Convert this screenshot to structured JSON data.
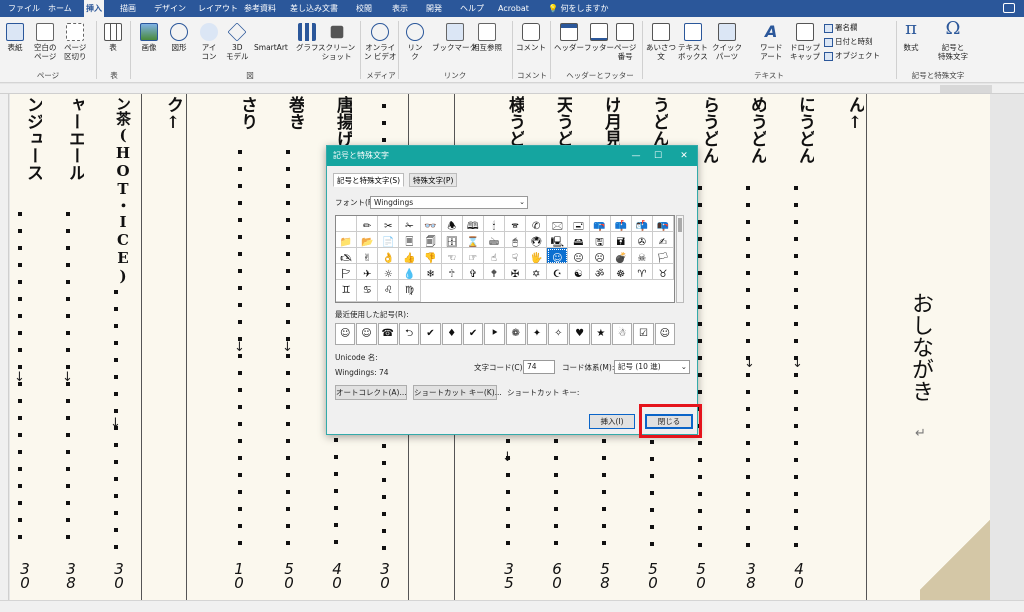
{
  "ribbon": {
    "tabs": [
      "ファイル",
      "ホーム",
      "挿入",
      "描画",
      "デザイン",
      "レイアウト",
      "参考資料",
      "差し込み文書",
      "校閲",
      "表示",
      "開発",
      "ヘルプ",
      "Acrobat"
    ],
    "active_tab": "挿入",
    "tell_me": "何をしますか",
    "buttons": {
      "cover": "表紙",
      "blank": "空白の\nページ",
      "pbreak": "ページ\n区切り",
      "table": "表",
      "picture": "画像",
      "shape": "図形",
      "icon": "アイ\nコン",
      "model3d": "3D\nモデル",
      "smartart": "SmartArt",
      "graph": "グラフ",
      "screenshot": "スクリーン\nショット",
      "online_video": "オンライ\nン ビデオ",
      "link": "リン\nク",
      "bookmark": "ブックマーク",
      "crossref": "相互参照",
      "comment": "コメント",
      "header": "ヘッダー",
      "footer": "フッター",
      "pagenum": "ページ\n番号",
      "greeting": "あいさつ\n文",
      "textbox": "テキスト\nボックス",
      "quickparts": "クイック\nパーツ",
      "wordart": "ワード\nアート",
      "dropcap": "ドロップ\nキャップ",
      "signature": "署名欄",
      "datetime": "日付と時刻",
      "object": "オブジェクト",
      "equation": "数式",
      "symbol": "記号と\n特殊文字"
    },
    "groups": [
      "ページ",
      "表",
      "図",
      "メディア",
      "リンク",
      "コメント",
      "ヘッダーとフッター",
      "テキスト",
      "記号と特殊文字"
    ]
  },
  "document": {
    "columns": [
      {
        "head": "ンジュース",
        "price": "3\n0"
      },
      {
        "head": "ャーエール",
        "price": "3\n8"
      },
      {
        "head": "ン茶(HOT・ICE)",
        "price": "3\n0"
      },
      {
        "head": "ク↑",
        "price": ""
      },
      {
        "head": "さり",
        "price": "1\n0"
      },
      {
        "head": "巻き",
        "price": "5\n0"
      },
      {
        "head": "唐揚げ",
        "price": "4\n0"
      },
      {
        "head": "",
        "price": "3\n0"
      },
      {
        "head": "様うど",
        "price": "3\n5"
      },
      {
        "head": "天うど",
        "price": "6\n0"
      },
      {
        "head": "け月見",
        "price": "5\n8"
      },
      {
        "head": "うどん",
        "price": "5\n0"
      },
      {
        "head": "らうどん",
        "price": "5\n0"
      },
      {
        "head": "めうどん",
        "price": "3\n8"
      },
      {
        "head": "にうどん",
        "price": "4\n0"
      },
      {
        "head": "ん↑",
        "price": ""
      }
    ],
    "title": "おしながき",
    "return_mark": "↵"
  },
  "dialog": {
    "title": "記号と特殊文字",
    "tab_symbols": "記号と特殊文字(S)",
    "tab_special": "特殊文字(P)",
    "font_label": "フォント(F):",
    "font_value": "Wingdings",
    "symbols": [
      "",
      "✏",
      "✂",
      "✁",
      "👓",
      "🕭",
      "🕮",
      "🕯",
      "🕿",
      "✆",
      "🖂",
      "🖃",
      "📪",
      "📫",
      "📬",
      "📭",
      "📁",
      "📂",
      "📄",
      "🗏",
      "🗐",
      "🗄",
      "⌛",
      "🖮",
      "🖰",
      "🖲",
      "🖳",
      "🖴",
      "🖫",
      "🖬",
      "✇",
      "✍",
      "🖎",
      "✌",
      "👌",
      "👍",
      "👎",
      "☜",
      "☞",
      "☝",
      "☟",
      "🖐",
      "☺",
      "😐",
      "☹",
      "💣",
      "☠",
      "🏳",
      "🏱",
      "✈",
      "☼",
      "💧",
      "❄",
      "🕆",
      "✞",
      "🕈",
      "✠",
      "✡",
      "☪",
      "☯",
      "ॐ",
      "☸",
      "♈",
      "♉",
      "♊",
      "♋",
      "♌",
      "♍"
    ],
    "selected_index": 42,
    "recent_label": "最近使用した記号(R):",
    "recent": [
      "☺",
      "☺",
      "☎",
      "⮌",
      "✔",
      "♦",
      "✔",
      "⯈",
      "❁",
      "✦",
      "✧",
      "♥",
      "★",
      "☃",
      "☑",
      "☺",
      "◇"
    ],
    "unicode_name_label": "Unicode 名:",
    "unicode_name_value": "Wingdings: 74",
    "char_code_label": "文字コード(C):",
    "char_code_value": "74",
    "code_system_label": "コード体系(M):",
    "code_system_value": "記号 (10 進)",
    "autocorrect_button": "オートコレクト(A)...",
    "shortcut_button": "ショートカット キー(K)...",
    "shortcut_label": "ショートカット キー:",
    "insert_button": "挿入(I)",
    "close_button": "閉じる"
  },
  "colors": {
    "ribbon_blue": "#2b579a",
    "dialog_title": "#15a5a0",
    "highlight": "#e5141c",
    "selected": "#0b6fd0"
  }
}
